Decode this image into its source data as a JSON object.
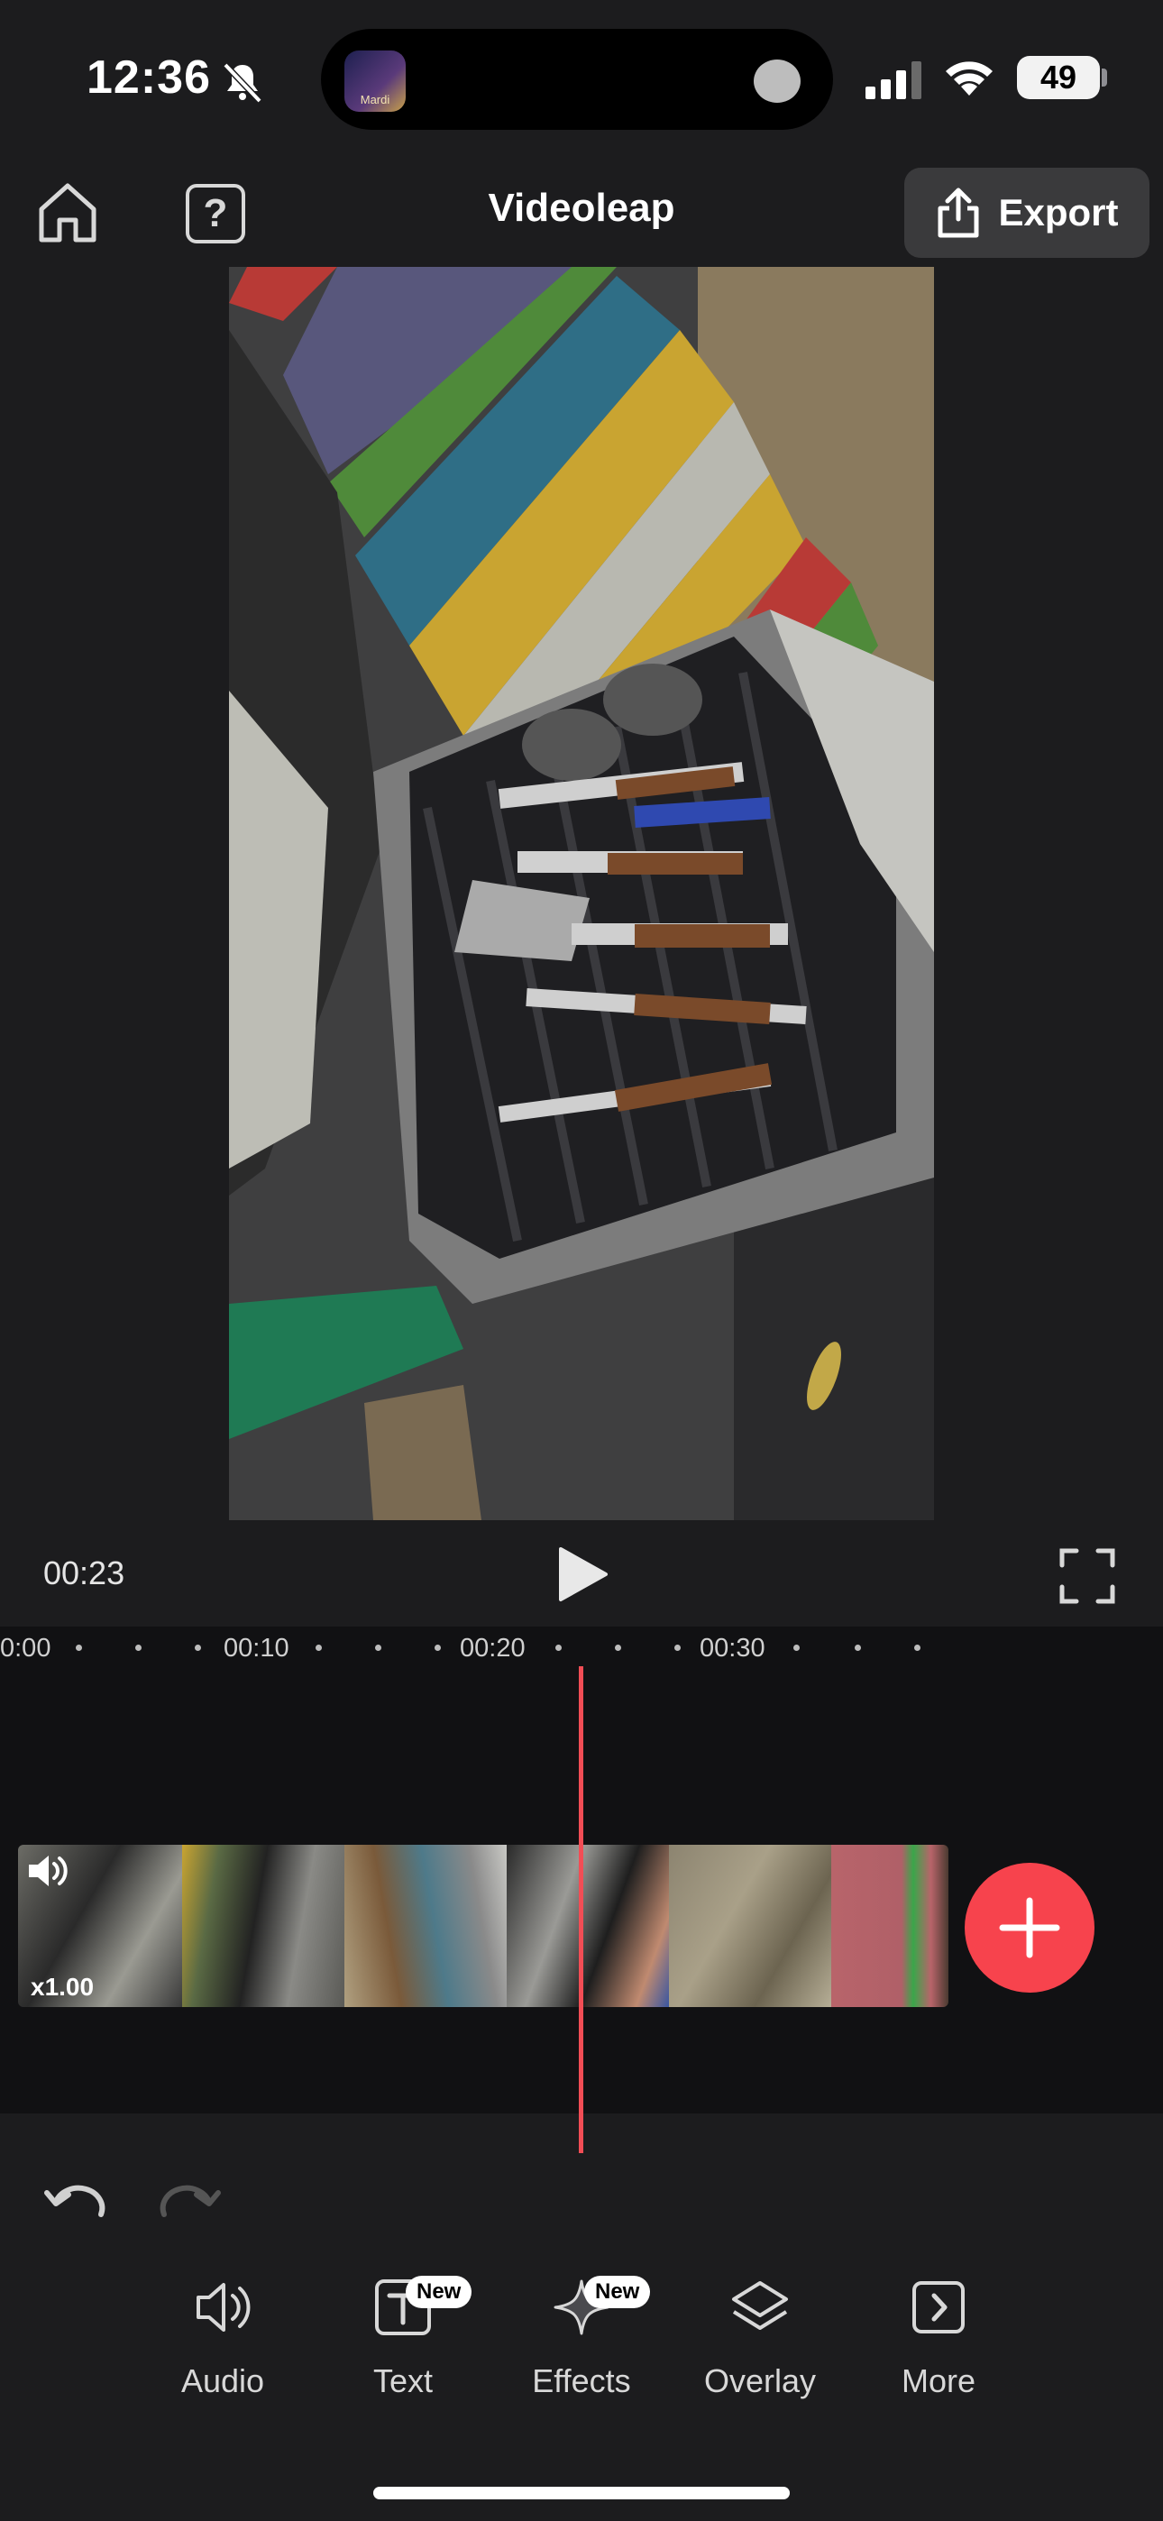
{
  "status_bar": {
    "time": "12:36",
    "battery": "49",
    "island_thumb_text": "Mardi"
  },
  "header": {
    "title": "Videoleap",
    "help_label": "?",
    "export_label": "Export"
  },
  "playback": {
    "timecode": "00:23"
  },
  "timeline": {
    "ruler": [
      "0:00",
      "00:10",
      "00:20",
      "00:30"
    ],
    "speed": "x1.00"
  },
  "toolbar": {
    "items": [
      {
        "label": "Audio",
        "icon": "speaker-icon",
        "badge": ""
      },
      {
        "label": "Text",
        "icon": "text-icon",
        "badge": "New"
      },
      {
        "label": "Effects",
        "icon": "sparkle-icon",
        "badge": "New"
      },
      {
        "label": "Overlay",
        "icon": "layers-icon",
        "badge": ""
      },
      {
        "label": "More",
        "icon": "chevron-right-icon",
        "badge": ""
      }
    ]
  },
  "colors": {
    "accent": "#f7434d",
    "playhead": "#f24d55",
    "background": "#1c1c1e"
  }
}
